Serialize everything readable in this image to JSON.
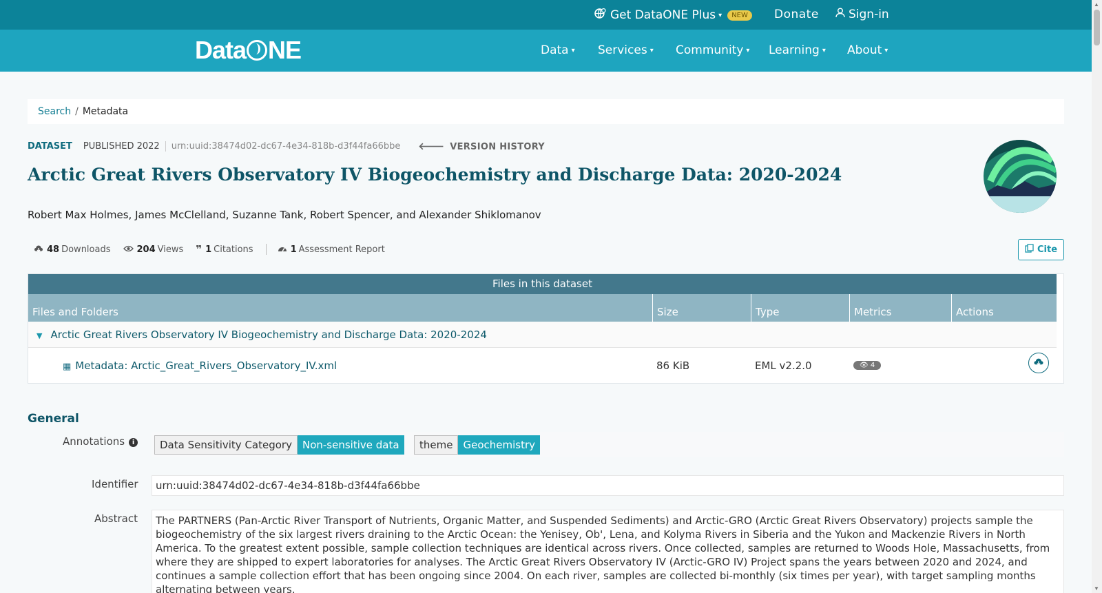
{
  "topbar": {
    "plus_label": "Get DataONE Plus",
    "new_badge": "NEW",
    "donate_label": "Donate",
    "signin_label": "Sign-in"
  },
  "navbar": {
    "logo_text_left": "Data",
    "logo_text_right": "NE",
    "items": [
      {
        "label": "Data"
      },
      {
        "label": "Services"
      },
      {
        "label": "Community"
      },
      {
        "label": "Learning"
      },
      {
        "label": "About"
      }
    ]
  },
  "breadcrumb": {
    "search": "Search",
    "separator": "/",
    "current": "Metadata"
  },
  "dataset": {
    "type_label": "DATASET",
    "published": "PUBLISHED 2022",
    "identifier": "urn:uuid:38474d02-dc67-4e34-818b-d3f44fa66bbe",
    "version_history": "VERSION HISTORY",
    "title": "Arctic Great Rivers Observatory IV Biogeochemistry and Discharge Data: 2020-2024",
    "authors": "Robert Max Holmes, James McClelland, Suzanne Tank, Robert Spencer, and Alexander Shiklomanov"
  },
  "stats": {
    "downloads_count": "48",
    "downloads_label": "Downloads",
    "views_count": "204",
    "views_label": "Views",
    "citations_count": "1",
    "citations_label": "Citations",
    "assessment_count": "1",
    "assessment_label": "Assessment Report",
    "cite_label": "Cite"
  },
  "files": {
    "header": "Files in this dataset",
    "columns": [
      "Files and Folders",
      "Size",
      "Type",
      "Metrics",
      "Actions"
    ],
    "folder_name": "Arctic Great Rivers Observatory IV Biogeochemistry and Discharge Data: 2020-2024",
    "rows": [
      {
        "name": "Metadata: Arctic_Great_Rivers_Observatory_IV.xml",
        "size": "86 KiB",
        "type": "EML v2.2.0",
        "views": "4"
      }
    ]
  },
  "general": {
    "section_title": "General",
    "annotations_label": "Annotations",
    "annotations": [
      {
        "key": "Data Sensitivity Category",
        "value": "Non-sensitive data"
      },
      {
        "key": "theme",
        "value": "Geochemistry"
      }
    ],
    "identifier_label": "Identifier",
    "identifier_value": "urn:uuid:38474d02-dc67-4e34-818b-d3f44fa66bbe",
    "abstract_label": "Abstract",
    "abstract_text": "The PARTNERS (Pan-Arctic River Transport of Nutrients, Organic Matter, and Suspended Sediments) and Arctic-GRO (Arctic Great Rivers Observatory) projects sample the biogeochemistry of the six largest rivers draining to the Arctic Ocean: the Yenisey, Ob', Lena, and Kolyma Rivers in Siberia and the Yukon and Mackenzie Rivers in North America. To the greatest extent possible, sample collection techniques are identical across rivers. Once collected, samples are returned to Woods Hole, Massachusetts, from where they are shipped to expert laboratories for analyses. The Arctic Great Rivers Observatory IV (Arctic-GRO IV) Project spans the years between 2020 and 2024, and continues a sample collection effort that has been ongoing since 2004. On each river, samples are collected bi-monthly (six times per year), with target sampling months alternating between years."
  },
  "colors": {
    "topbar": "#0c8399",
    "navbar": "#1ea5bf",
    "accent": "#1fa8bd",
    "title": "#0e5567"
  }
}
